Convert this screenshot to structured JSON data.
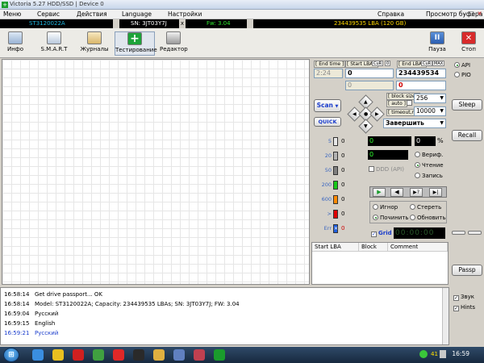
{
  "window": {
    "title": "Victoria 5.27 HDD/SSD | Device 0",
    "icon_glyph": "+"
  },
  "menu": [
    "Меню",
    "Сервис",
    "Действия",
    "Language",
    "Настройки",
    "Справка",
    "Просмотр буфера"
  ],
  "window_buttons": {
    "minimize": "–",
    "maximize": "□",
    "close": "✕"
  },
  "infobar": {
    "model": "ST3120022A",
    "serial": "SN: 3JT03Y7J",
    "sep": "x",
    "firmware": "Fw: 3.04",
    "lba": "234439535 LBA (120 GB)",
    "colors": {
      "model": "#1fb8e0",
      "serial": "#ffffff",
      "firmware": "#2ee52e",
      "lba": "#ffd800"
    }
  },
  "toolbar": {
    "info": "Инфо",
    "smart": "S.M.A.R.T",
    "logs": "Журналы",
    "test": "Тестирование",
    "editor": "Редактор",
    "pause": "Пауза",
    "stop": "Стоп",
    "test_glyph": "+",
    "pause_glyph": "II",
    "stop_glyph": "✕"
  },
  "panel": {
    "end_time_label": "[ End time ]",
    "start_lba_label": "[ Start LBA ]",
    "cur_label": "CuR",
    "zero_label": "0",
    "end_lba_label": "[ End LBA ]",
    "max_label": "MAX",
    "time_value": "2:24",
    "start_lba_value": "0",
    "end_lba_value": "234439534",
    "start_lba_current": "0",
    "end_lba_current": "0",
    "block_size_label": "[ block size ]",
    "auto_label": "[ auto ]",
    "timeout_label": "[ timeout,ms ]",
    "block_size_value": "256",
    "timeout_value": "10000",
    "scan_button": "Scan",
    "quick_button": "QUICK",
    "finish_select": "Завершить",
    "dropdown_arrow": "▼",
    "dpad": {
      "up": "▲",
      "down": "▼",
      "left": "◀",
      "right": "▶",
      "center": "●"
    },
    "categories": [
      {
        "name": "5",
        "count": "0",
        "color": "#e8e8e8"
      },
      {
        "name": "20",
        "count": "0",
        "color": "#b4b4b4"
      },
      {
        "name": "50",
        "count": "0",
        "color": "#808080"
      },
      {
        "name": "200",
        "count": "0",
        "color": "#18c818"
      },
      {
        "name": "600",
        "count": "0",
        "color": "#ff8a00"
      },
      {
        "name": ">",
        "count": "0",
        "color": "#e00000"
      },
      {
        "name": "Err",
        "count": "0",
        "color": "#2060e0"
      }
    ],
    "err_glyph": "✕",
    "progress_value": "0",
    "progress_percent": "0",
    "percent_sign": "%",
    "counter_value": "0",
    "ddd_label": "DDD (API)",
    "verify_label": "Вериф.",
    "read_label": "Чтение",
    "write_label": "Запись",
    "play_glyphs": [
      "▶",
      "◀",
      "▶?",
      "▶|"
    ],
    "ignore_label": "Игнор",
    "erase_label": "Стереть",
    "repair_label": "Починить",
    "refresh_label": "Обновить",
    "grid_label": "Grid",
    "grid_check": "✓",
    "timer_value": "00:00:00",
    "table_headers": [
      "Start LBA",
      "Block",
      "Comment"
    ]
  },
  "rightcol": {
    "api_label": "API",
    "pio_label": "PIO",
    "sleep_button": "Sleep",
    "recall_button": "Recall",
    "passp_button": "Passp"
  },
  "log": [
    {
      "time": "16:58:14",
      "text": "Get drive passport... OK",
      "color": "#000000"
    },
    {
      "time": "16:58:14",
      "text": "Model: ST3120022A; Capacity: 234439535 LBAs; SN: 3JT03Y7J; FW: 3.04",
      "color": "#000000"
    },
    {
      "time": "16:59:04",
      "text": "Русский",
      "color": "#000000"
    },
    {
      "time": "16:59:15",
      "text": "English",
      "color": "#000000"
    },
    {
      "time": "16:59:21",
      "text": "Русский",
      "color": "#1a3ccc"
    }
  ],
  "log_options": {
    "sound_label": "Звук",
    "hints_label": "Hints",
    "check": "✓"
  },
  "taskbar": {
    "start_glyph": "⊞",
    "tray_number": "41",
    "clock": "16:59",
    "icon_colors": [
      "#3a8ee0",
      "#e8c020",
      "#d02020",
      "#40a040",
      "#e02828",
      "#2a2a2a",
      "#e0b040",
      "#6080c0",
      "#c04050",
      "#1a9c2c"
    ]
  }
}
